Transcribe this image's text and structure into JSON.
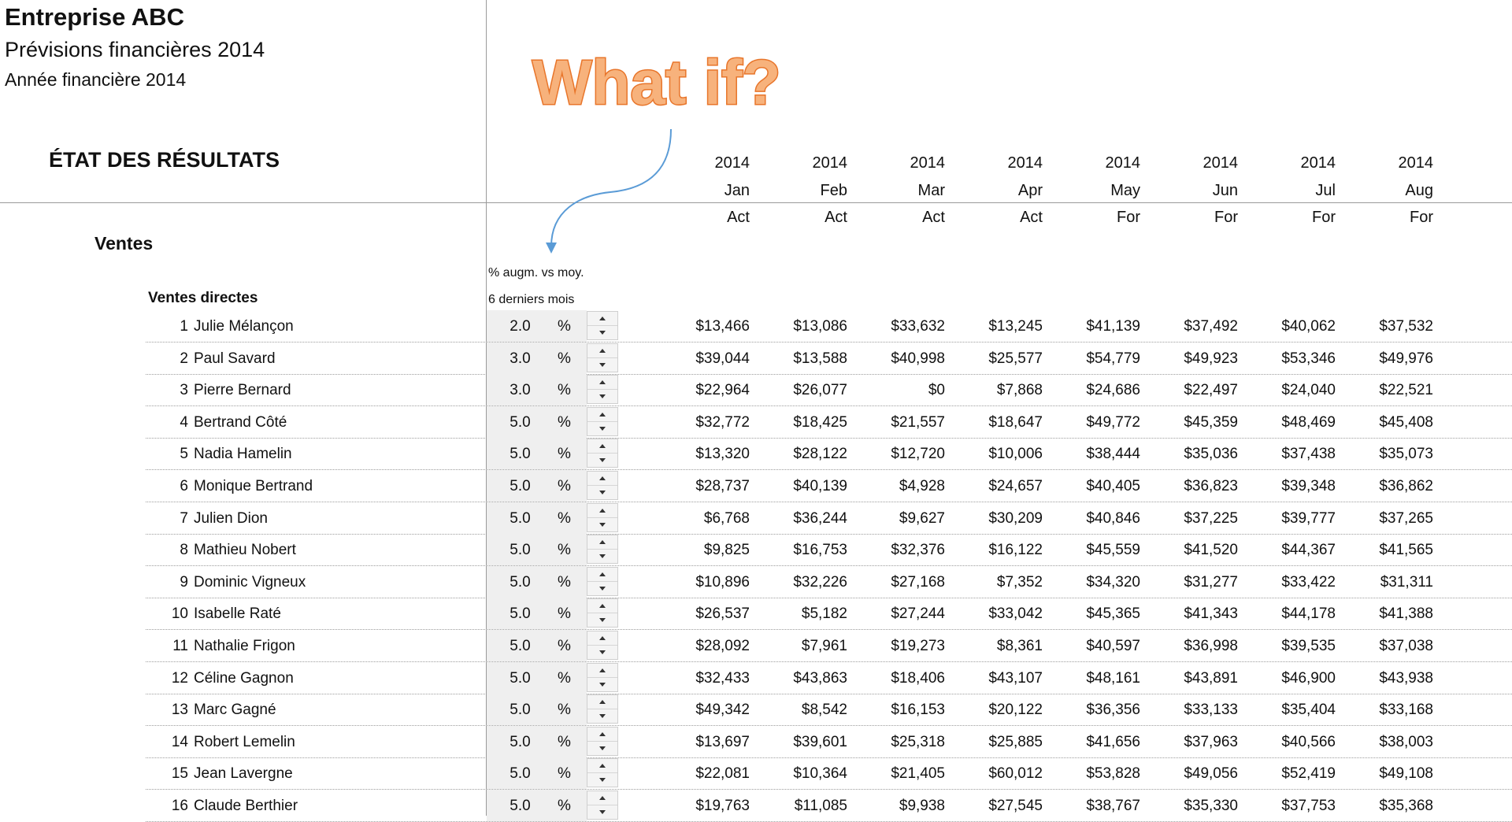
{
  "header": {
    "company": "Entreprise ABC",
    "forecast_title": "Prévisions financières 2014",
    "fiscal_year": "Année financière 2014",
    "statement_title": "ÉTAT DES RÉSULTATS",
    "annotation": "What if?",
    "annotation_color": "#f0903a"
  },
  "columns": [
    {
      "year": "2014",
      "month": "Jan",
      "type": "Act"
    },
    {
      "year": "2014",
      "month": "Feb",
      "type": "Act"
    },
    {
      "year": "2014",
      "month": "Mar",
      "type": "Act"
    },
    {
      "year": "2014",
      "month": "Apr",
      "type": "Act"
    },
    {
      "year": "2014",
      "month": "May",
      "type": "For"
    },
    {
      "year": "2014",
      "month": "Jun",
      "type": "For"
    },
    {
      "year": "2014",
      "month": "Jul",
      "type": "For"
    },
    {
      "year": "2014",
      "month": "Aug",
      "type": "For"
    }
  ],
  "section": {
    "title": "Ventes",
    "subsection": "Ventes directes",
    "pct_note_line1": "% augm. vs moy.",
    "pct_note_line2": "6 derniers mois"
  },
  "rows": [
    {
      "num": "1",
      "name": "Julie Mélançon",
      "pct": "2.0",
      "unit": "%",
      "values": [
        "$13,466",
        "$13,086",
        "$33,632",
        "$13,245",
        "$41,139",
        "$37,492",
        "$40,062",
        "$37,532"
      ]
    },
    {
      "num": "2",
      "name": "Paul Savard",
      "pct": "3.0",
      "unit": "%",
      "values": [
        "$39,044",
        "$13,588",
        "$40,998",
        "$25,577",
        "$54,779",
        "$49,923",
        "$53,346",
        "$49,976"
      ]
    },
    {
      "num": "3",
      "name": "Pierre Bernard",
      "pct": "3.0",
      "unit": "%",
      "values": [
        "$22,964",
        "$26,077",
        "$0",
        "$7,868",
        "$24,686",
        "$22,497",
        "$24,040",
        "$22,521"
      ]
    },
    {
      "num": "4",
      "name": "Bertrand Côté",
      "pct": "5.0",
      "unit": "%",
      "values": [
        "$32,772",
        "$18,425",
        "$21,557",
        "$18,647",
        "$49,772",
        "$45,359",
        "$48,469",
        "$45,408"
      ]
    },
    {
      "num": "5",
      "name": "Nadia Hamelin",
      "pct": "5.0",
      "unit": "%",
      "values": [
        "$13,320",
        "$28,122",
        "$12,720",
        "$10,006",
        "$38,444",
        "$35,036",
        "$37,438",
        "$35,073"
      ]
    },
    {
      "num": "6",
      "name": "Monique Bertrand",
      "pct": "5.0",
      "unit": "%",
      "values": [
        "$28,737",
        "$40,139",
        "$4,928",
        "$24,657",
        "$40,405",
        "$36,823",
        "$39,348",
        "$36,862"
      ]
    },
    {
      "num": "7",
      "name": "Julien Dion",
      "pct": "5.0",
      "unit": "%",
      "values": [
        "$6,768",
        "$36,244",
        "$9,627",
        "$30,209",
        "$40,846",
        "$37,225",
        "$39,777",
        "$37,265"
      ]
    },
    {
      "num": "8",
      "name": "Mathieu Nobert",
      "pct": "5.0",
      "unit": "%",
      "values": [
        "$9,825",
        "$16,753",
        "$32,376",
        "$16,122",
        "$45,559",
        "$41,520",
        "$44,367",
        "$41,565"
      ]
    },
    {
      "num": "9",
      "name": "Dominic Vigneux",
      "pct": "5.0",
      "unit": "%",
      "values": [
        "$10,896",
        "$32,226",
        "$27,168",
        "$7,352",
        "$34,320",
        "$31,277",
        "$33,422",
        "$31,311"
      ]
    },
    {
      "num": "10",
      "name": "Isabelle Raté",
      "pct": "5.0",
      "unit": "%",
      "values": [
        "$26,537",
        "$5,182",
        "$27,244",
        "$33,042",
        "$45,365",
        "$41,343",
        "$44,178",
        "$41,388"
      ]
    },
    {
      "num": "11",
      "name": "Nathalie Frigon",
      "pct": "5.0",
      "unit": "%",
      "values": [
        "$28,092",
        "$7,961",
        "$19,273",
        "$8,361",
        "$40,597",
        "$36,998",
        "$39,535",
        "$37,038"
      ]
    },
    {
      "num": "12",
      "name": "Céline Gagnon",
      "pct": "5.0",
      "unit": "%",
      "values": [
        "$32,433",
        "$43,863",
        "$18,406",
        "$43,107",
        "$48,161",
        "$43,891",
        "$46,900",
        "$43,938"
      ]
    },
    {
      "num": "13",
      "name": "Marc Gagné",
      "pct": "5.0",
      "unit": "%",
      "values": [
        "$49,342",
        "$8,542",
        "$16,153",
        "$20,122",
        "$36,356",
        "$33,133",
        "$35,404",
        "$33,168"
      ]
    },
    {
      "num": "14",
      "name": "Robert Lemelin",
      "pct": "5.0",
      "unit": "%",
      "values": [
        "$13,697",
        "$39,601",
        "$25,318",
        "$25,885",
        "$41,656",
        "$37,963",
        "$40,566",
        "$38,003"
      ]
    },
    {
      "num": "15",
      "name": "Jean Lavergne",
      "pct": "5.0",
      "unit": "%",
      "values": [
        "$22,081",
        "$10,364",
        "$21,405",
        "$60,012",
        "$53,828",
        "$49,056",
        "$52,419",
        "$49,108"
      ]
    },
    {
      "num": "16",
      "name": "Claude Berthier",
      "pct": "5.0",
      "unit": "%",
      "values": [
        "$19,763",
        "$11,085",
        "$9,938",
        "$27,545",
        "$38,767",
        "$35,330",
        "$37,753",
        "$35,368"
      ]
    }
  ]
}
